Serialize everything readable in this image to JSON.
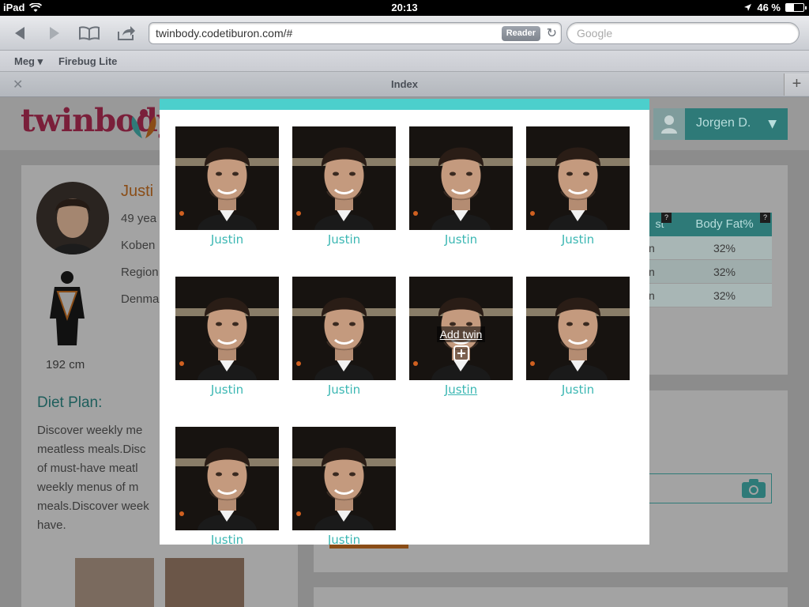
{
  "status_bar": {
    "device": "iPad",
    "time": "20:13",
    "battery": "46 %",
    "battery_level": 0.46
  },
  "browser": {
    "url": "twinbody.codetiburon.com/#",
    "reader_label": "Reader",
    "search_placeholder": "Google",
    "bookmarks": [
      {
        "label": "Meg ▾"
      },
      {
        "label": "Firebug Lite"
      }
    ],
    "tab_title": "Index",
    "new_tab": "+",
    "close_tab": "✕"
  },
  "page": {
    "logo_text": "twinbody",
    "user_name": "Jorgen D.",
    "profile": {
      "name": "Justi",
      "age": "49 yea",
      "city": "Koben",
      "region": "Region",
      "country": "Denma",
      "height": "192 cm"
    },
    "diet": {
      "title": "Diet Plan:",
      "lines": [
        "Discover weekly me",
        "meatless meals.Disc",
        "of must-have meatl",
        "weekly menus of m",
        "meals.Discover week",
        "have."
      ]
    },
    "stats": {
      "headers": [
        "st",
        "Body Fat%"
      ],
      "help": "?",
      "rows": [
        {
          "c1": "n",
          "c2": "32%"
        },
        {
          "c1": "n",
          "c2": "32%"
        },
        {
          "c1": "n",
          "c2": "32%"
        }
      ]
    }
  },
  "modal": {
    "twins": [
      {
        "name": "Justin"
      },
      {
        "name": "Justin"
      },
      {
        "name": "Justin"
      },
      {
        "name": "Justin"
      },
      {
        "name": "Justin"
      },
      {
        "name": "Justin"
      },
      {
        "name": "Justin",
        "hover": true
      },
      {
        "name": "Justin"
      },
      {
        "name": "Justin"
      },
      {
        "name": "Justin"
      }
    ],
    "add_twin_label": "Add twin"
  },
  "colors": {
    "accent": "#4ccfcc",
    "caption": "#3bb7b3",
    "brand": "#7a1f3a"
  }
}
